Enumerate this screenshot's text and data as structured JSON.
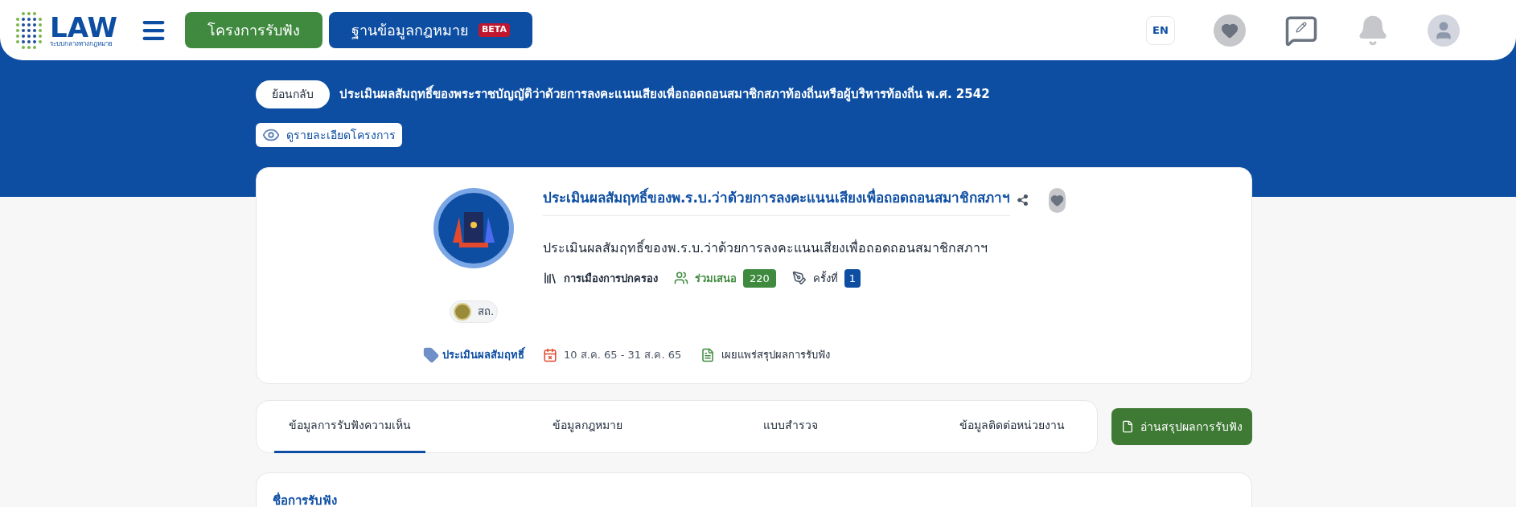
{
  "header": {
    "logo_text": "LAW",
    "logo_subtitle": "ระบบกลางทางกฎหมาย",
    "nav_buttons": [
      {
        "label": "โครงการรับฟัง",
        "kind": "primary"
      },
      {
        "label": "ฐานข้อมูลกฎหมาย",
        "kind": "secondary",
        "badge": "BETA"
      }
    ],
    "language": "EN"
  },
  "banner": {
    "back_button": "ย้อนกลับ",
    "title": "ประเมินผลสัมฤทธิ์ของพระราชบัญญัติว่าด้วยการลงคะแนนเสียงเพื่อถอดถอนสมาชิกสภาท้องถิ่นหรือผู้บริหารท้องถิ่น พ.ศ. 2542",
    "details_button": "ดูรายละเอียดโครงการ"
  },
  "project": {
    "agency": "สถ.",
    "category_tag": "ประเมินผลสัมฤทธิ์",
    "title": "ประเมินผลสัมฤทธิ์ของพ.ร.บ.ว่าด้วยการลงคะแนนเสียงเพื่อถอดถอนสมาชิกสภาฯ",
    "description": "ประเมินผลสัมฤทธิ์ของพ.ร.บ.ว่าด้วยการลงคะแนนเสียงเพื่อถอดถอนสมาชิกสภาฯ",
    "topic": "การเมืองการปกครอง",
    "participants_label": "ร่วมเสนอ",
    "participants_count": "220",
    "round_label": "ครั้งที่",
    "round_number": "1",
    "date_range": "10 ส.ค. 65 - 31 ส.ค. 65",
    "publication": "เผยแพร่สรุปผลการรับฟัง"
  },
  "tabs": [
    {
      "label": "ข้อมูลการรับฟังความเห็น",
      "selected": true
    },
    {
      "label": "ข้อมูลกฎหมาย",
      "selected": false
    },
    {
      "label": "แบบสำรวจ",
      "selected": false
    },
    {
      "label": "ข้อมูลติดต่อหน่วยงาน",
      "selected": false
    }
  ],
  "summary_button": "อ่านสรุปผลการรับฟัง",
  "section": {
    "heading": "ชื่อการรับฟัง"
  }
}
